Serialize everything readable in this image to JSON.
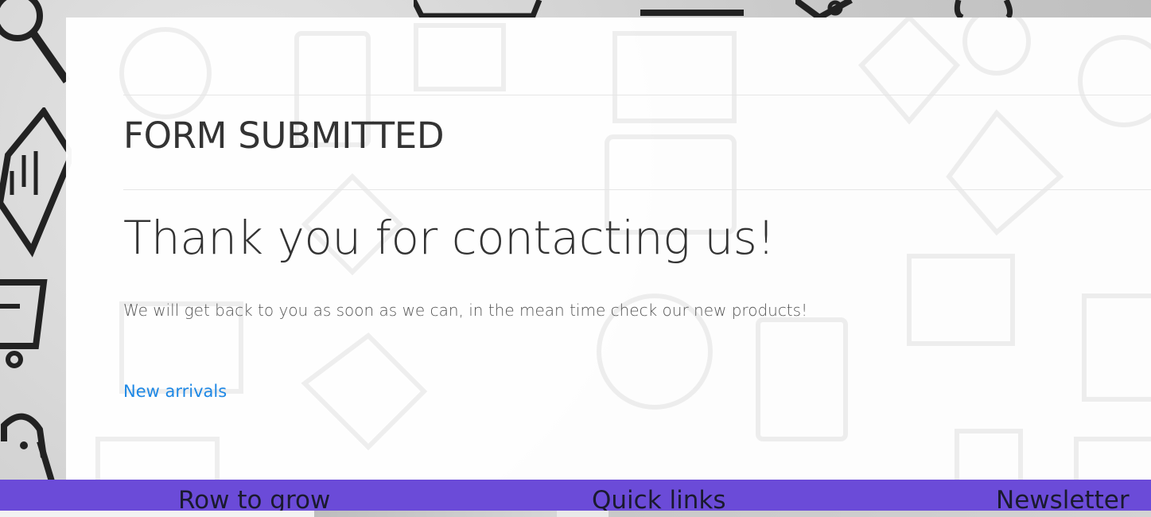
{
  "page": {
    "kicker": "FORM SUBMITTED",
    "headline": "Thank you for contacting us!",
    "lead": "We will get back to you as soon as we can, in the mean time check our new products!",
    "link_label": "New arrivals"
  },
  "footer": {
    "col1": "Row to grow",
    "col2": "Quick links",
    "col3": "Newsletter"
  },
  "colors": {
    "accent_purple": "#6b4bd8",
    "link_blue": "#1e88e5"
  },
  "icons": [
    "magnifier-icon",
    "laptop-icon",
    "shopping-cart-icon",
    "shopping-bag-icon",
    "credit-card-icon",
    "price-tag-icon",
    "percent-icon",
    "gift-icon",
    "store-icon"
  ]
}
